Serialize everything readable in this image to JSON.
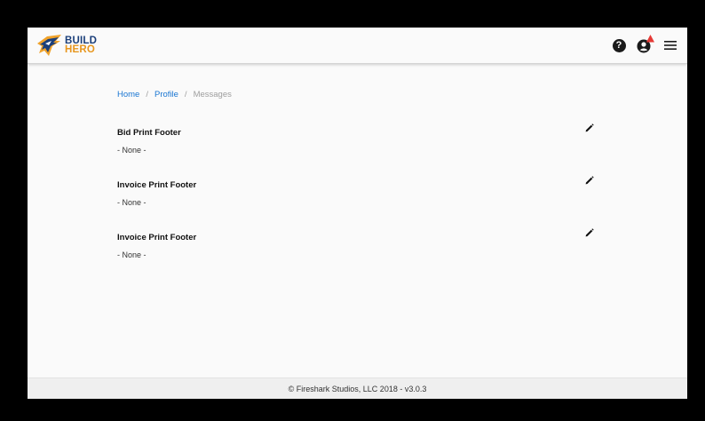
{
  "header": {
    "logo": {
      "line1": "BUILD",
      "line2": "HERO",
      "icon": "buildhero-bird-logo"
    },
    "actions": [
      {
        "name": "help",
        "icon": "help-circle-icon"
      },
      {
        "name": "account",
        "icon": "account-circle-icon"
      },
      {
        "name": "menu",
        "icon": "hamburger-menu-icon"
      }
    ]
  },
  "breadcrumb": {
    "items": [
      "Home",
      "Profile",
      "Messages"
    ],
    "separator": "/"
  },
  "sections": [
    {
      "title": "Bid Print Footer",
      "value": "- None -",
      "action_icon": "pencil-icon"
    },
    {
      "title": "Invoice Print Footer",
      "value": "- None -",
      "action_icon": "pencil-icon"
    },
    {
      "title": "Invoice Print Footer",
      "value": "- None -",
      "action_icon": "pencil-icon"
    }
  ],
  "footer": {
    "text": "© Fireshark Studios, LLC 2018 - v3.0.3"
  },
  "colors": {
    "link": "#1976d2",
    "brand_blue": "#1b3f7a",
    "brand_orange": "#e7961d",
    "alert": "#e53935"
  }
}
